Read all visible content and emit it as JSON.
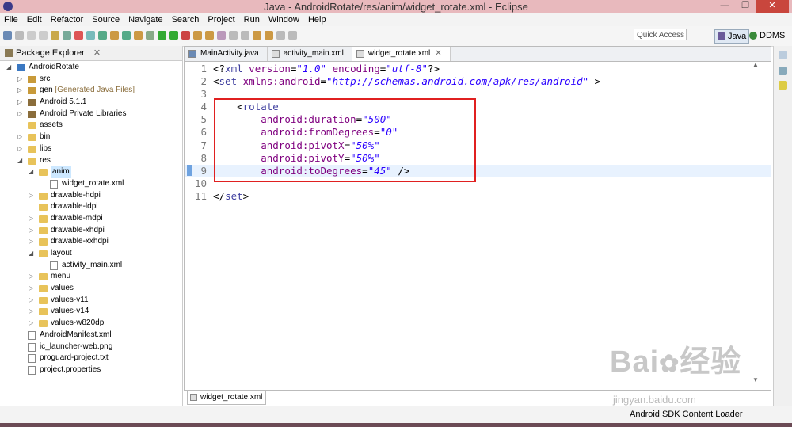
{
  "window": {
    "title": "Java - AndroidRotate/res/anim/widget_rotate.xml - Eclipse",
    "min": "—",
    "max": "❐",
    "close": "✕"
  },
  "menubar": {
    "items": [
      "File",
      "Edit",
      "Refactor",
      "Source",
      "Navigate",
      "Search",
      "Project",
      "Run",
      "Window",
      "Help"
    ]
  },
  "toolbar": {
    "quick_access": "Quick Access",
    "perspectives": [
      {
        "label": "Java",
        "active": true,
        "color": "#6a5a9a"
      },
      {
        "label": "DDMS",
        "active": false,
        "color": "#3a8a3a"
      }
    ]
  },
  "explorer": {
    "title": "Package Explorer",
    "close": "✕",
    "items": [
      {
        "label": "AndroidRotate",
        "depth": 0,
        "expanded": true,
        "icon": "project-icon"
      },
      {
        "label": "src",
        "depth": 1,
        "expanded": false,
        "icon": "package-folder-icon"
      },
      {
        "label": "gen",
        "extra": " [Generated Java Files]",
        "depth": 1,
        "expanded": false,
        "icon": "package-folder-icon"
      },
      {
        "label": "Android 5.1.1",
        "depth": 1,
        "expanded": false,
        "icon": "library-icon"
      },
      {
        "label": "Android Private Libraries",
        "depth": 1,
        "expanded": false,
        "icon": "library-icon"
      },
      {
        "label": "assets",
        "depth": 1,
        "expanded": null,
        "icon": "folder-icon"
      },
      {
        "label": "bin",
        "depth": 1,
        "expanded": false,
        "icon": "folder-icon"
      },
      {
        "label": "libs",
        "depth": 1,
        "expanded": false,
        "icon": "folder-icon"
      },
      {
        "label": "res",
        "depth": 1,
        "expanded": true,
        "icon": "folder-icon"
      },
      {
        "label": "anim",
        "depth": 2,
        "expanded": true,
        "icon": "folder-icon",
        "selected": true
      },
      {
        "label": "widget_rotate.xml",
        "depth": 3,
        "expanded": null,
        "icon": "xml-file-icon"
      },
      {
        "label": "drawable-hdpi",
        "depth": 2,
        "expanded": false,
        "icon": "folder-icon"
      },
      {
        "label": "drawable-ldpi",
        "depth": 2,
        "expanded": null,
        "icon": "folder-icon"
      },
      {
        "label": "drawable-mdpi",
        "depth": 2,
        "expanded": false,
        "icon": "folder-icon"
      },
      {
        "label": "drawable-xhdpi",
        "depth": 2,
        "expanded": false,
        "icon": "folder-icon"
      },
      {
        "label": "drawable-xxhdpi",
        "depth": 2,
        "expanded": false,
        "icon": "folder-icon"
      },
      {
        "label": "layout",
        "depth": 2,
        "expanded": true,
        "icon": "folder-icon"
      },
      {
        "label": "activity_main.xml",
        "depth": 3,
        "expanded": null,
        "icon": "xml-file-icon"
      },
      {
        "label": "menu",
        "depth": 2,
        "expanded": false,
        "icon": "folder-icon"
      },
      {
        "label": "values",
        "depth": 2,
        "expanded": false,
        "icon": "folder-icon"
      },
      {
        "label": "values-v11",
        "depth": 2,
        "expanded": false,
        "icon": "folder-icon"
      },
      {
        "label": "values-v14",
        "depth": 2,
        "expanded": false,
        "icon": "folder-icon"
      },
      {
        "label": "values-w820dp",
        "depth": 2,
        "expanded": false,
        "icon": "folder-icon"
      },
      {
        "label": "AndroidManifest.xml",
        "depth": 1,
        "expanded": null,
        "icon": "xml-file-icon"
      },
      {
        "label": "ic_launcher-web.png",
        "depth": 1,
        "expanded": null,
        "icon": "image-file-icon"
      },
      {
        "label": "proguard-project.txt",
        "depth": 1,
        "expanded": null,
        "icon": "text-file-icon"
      },
      {
        "label": "project.properties",
        "depth": 1,
        "expanded": null,
        "icon": "text-file-icon"
      }
    ]
  },
  "editor": {
    "tabs": [
      {
        "label": "MainActivity.java",
        "active": false
      },
      {
        "label": "activity_main.xml",
        "active": false
      },
      {
        "label": "widget_rotate.xml",
        "active": true
      }
    ],
    "close": "✕",
    "lines": [
      {
        "n": "1",
        "html": [
          [
            "pun",
            "<?"
          ],
          [
            "tag",
            "xml "
          ],
          [
            "att",
            "version"
          ],
          [
            "pun",
            "="
          ],
          [
            "val",
            "\"1.0\""
          ],
          [
            "pun",
            " "
          ],
          [
            "att",
            "encoding"
          ],
          [
            "pun",
            "="
          ],
          [
            "val",
            "\"utf-8\""
          ],
          [
            "pun",
            "?>"
          ]
        ]
      },
      {
        "n": "2",
        "html": [
          [
            "pun",
            "<"
          ],
          [
            "tag",
            "set "
          ],
          [
            "att",
            "xmlns:android"
          ],
          [
            "pun",
            "="
          ],
          [
            "val",
            "\"http://schemas.android.com/apk/res/android\""
          ],
          [
            "pun",
            " >"
          ]
        ]
      },
      {
        "n": "3",
        "html": []
      },
      {
        "n": "4",
        "html": [
          [
            "pun",
            "    <"
          ],
          [
            "tag",
            "rotate"
          ]
        ]
      },
      {
        "n": "5",
        "html": [
          [
            "pun",
            "        "
          ],
          [
            "att",
            "android:duration"
          ],
          [
            "pun",
            "="
          ],
          [
            "val",
            "\"500\""
          ]
        ]
      },
      {
        "n": "6",
        "html": [
          [
            "pun",
            "        "
          ],
          [
            "att",
            "android:fromDegrees"
          ],
          [
            "pun",
            "="
          ],
          [
            "val",
            "\"0\""
          ]
        ]
      },
      {
        "n": "7",
        "html": [
          [
            "pun",
            "        "
          ],
          [
            "att",
            "android:pivotX"
          ],
          [
            "pun",
            "="
          ],
          [
            "val",
            "\"50%\""
          ]
        ]
      },
      {
        "n": "8",
        "html": [
          [
            "pun",
            "        "
          ],
          [
            "att",
            "android:pivotY"
          ],
          [
            "pun",
            "="
          ],
          [
            "val",
            "\"50%\""
          ]
        ]
      },
      {
        "n": "9",
        "html": [
          [
            "pun",
            "        "
          ],
          [
            "att",
            "android:toDegrees"
          ],
          [
            "pun",
            "="
          ],
          [
            "val",
            "\"45\""
          ],
          [
            "pun",
            " />"
          ]
        ],
        "current": true
      },
      {
        "n": "10",
        "html": []
      },
      {
        "n": "11",
        "html": [
          [
            "pun",
            "</"
          ],
          [
            "tag",
            "set"
          ],
          [
            "pun",
            ">"
          ]
        ]
      }
    ],
    "bottom_tab": "widget_rotate.xml"
  },
  "status": {
    "text": "Android SDK Content Loader"
  },
  "watermark": {
    "main": "Bai",
    "sub": "jingyan.baidu.com"
  }
}
